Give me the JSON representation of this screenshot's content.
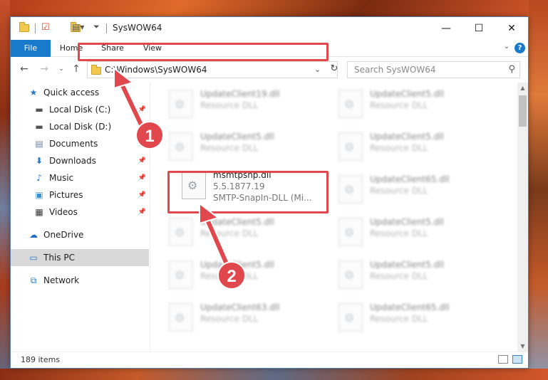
{
  "window": {
    "title": "SysWOW64"
  },
  "controls": {
    "minimize": "—",
    "maximize": "☐",
    "close": "✕"
  },
  "ribbon": {
    "tabs": [
      "File",
      "Home",
      "Share",
      "View"
    ],
    "help": "?"
  },
  "address": {
    "path": "C:\\Windows\\SysWOW64"
  },
  "search": {
    "placeholder": "Search SysWOW64"
  },
  "sidebar": {
    "items": [
      {
        "label": "Quick access",
        "icon": "star-icon"
      },
      {
        "label": "Local Disk (C:)",
        "icon": "drive-icon",
        "pinned": true
      },
      {
        "label": "Local Disk (D:)",
        "icon": "drive-icon"
      },
      {
        "label": "Documents",
        "icon": "document-icon",
        "pinned": true
      },
      {
        "label": "Downloads",
        "icon": "download-icon",
        "pinned": true
      },
      {
        "label": "Music",
        "icon": "music-icon",
        "pinned": true
      },
      {
        "label": "Pictures",
        "icon": "picture-icon",
        "pinned": true
      },
      {
        "label": "Videos",
        "icon": "video-icon",
        "pinned": true
      },
      {
        "label": "OneDrive",
        "icon": "cloud-icon"
      },
      {
        "label": "This PC",
        "icon": "monitor-icon",
        "selected": true
      },
      {
        "label": "Network",
        "icon": "network-icon"
      }
    ]
  },
  "files": [
    {
      "name": "UpdateClient19.dll",
      "type": "Resource DLL"
    },
    {
      "name": "UpdateClient5.dll",
      "type": "Resource DLL"
    },
    {
      "name": "UpdateClient5.dll",
      "type": "Resource DLL"
    },
    {
      "name": "UpdateClient5.dll",
      "type": "Resource DLL"
    },
    {
      "name": "msmtpsnp.dll",
      "version": "5.5.1877.19",
      "description": "SMTP-SnapIn-DLL (Mi..."
    },
    {
      "name": "UpdateClient65.dll",
      "type": "Resource DLL"
    },
    {
      "name": "UpdateClient5.dll",
      "type": "Resource DLL"
    },
    {
      "name": "UpdateClient5.dll",
      "type": "Resource DLL"
    },
    {
      "name": "UpdateClient5.dll",
      "type": "Resource DLL"
    },
    {
      "name": "UpdateClient5.dll",
      "type": "Resource DLL"
    },
    {
      "name": "UpdateClient63.dll",
      "type": "Resource DLL"
    },
    {
      "name": "UpdateClient65.dll",
      "type": "Resource DLL"
    }
  ],
  "status": {
    "item_count": "189 items"
  },
  "callouts": {
    "step1": "1",
    "step2": "2"
  },
  "colors": {
    "accent": "#1979ca",
    "highlight": "#e0484e",
    "selected": "#d9d9d9"
  }
}
